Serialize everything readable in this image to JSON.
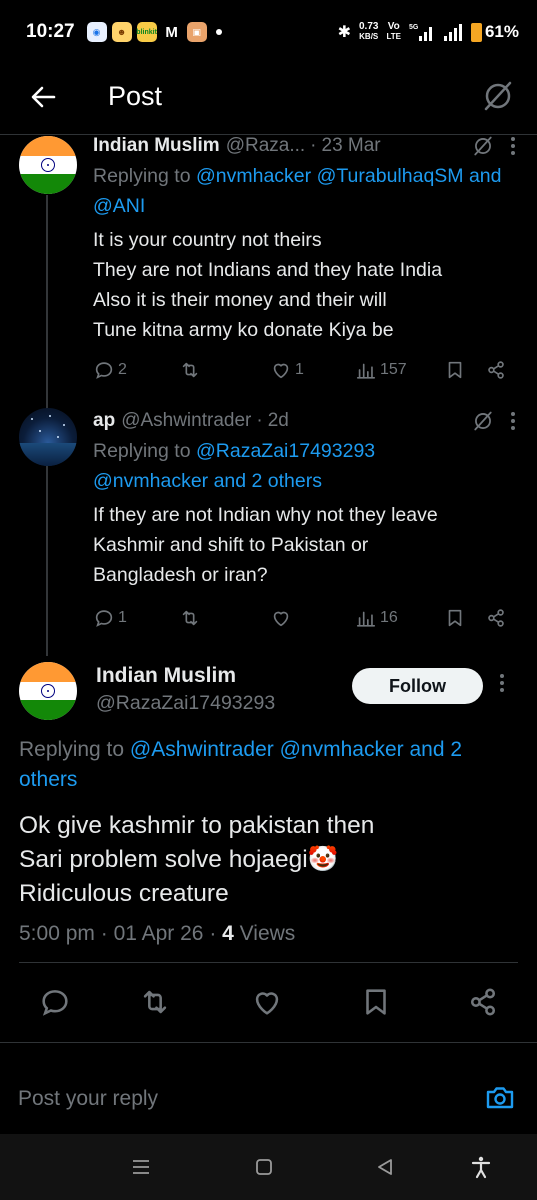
{
  "status_bar": {
    "time": "10:27",
    "net_speed": "0.73",
    "net_unit": "KB/S",
    "volte": "Vo",
    "lte": "LTE",
    "signal_5g": "5G",
    "battery": "61%",
    "notif_icons": [
      "blinkit",
      "gmail",
      "app"
    ]
  },
  "header": {
    "title": "Post",
    "back_icon": "arrow-left-icon",
    "grok_icon": "grok-icon"
  },
  "tweets": [
    {
      "name": "Indian Muslim",
      "handle": "@Raza...",
      "date": "23 Mar",
      "reply_prefix": "Replying to ",
      "reply_mentions": "@nvmhacker @TurabulhaqSM and @ANI",
      "lines": [
        "It is your country not theirs",
        "They are not Indians and they hate India",
        "Also it is their money and their will",
        "Tune kitna army ko donate Kiya be"
      ],
      "replies": "2",
      "reposts": "",
      "likes": "1",
      "views": "157"
    },
    {
      "name": "ap",
      "handle": "@Ashwintrader",
      "date": "2d",
      "reply_prefix": "Replying to ",
      "reply_mentions_line1": "@RazaZai17493293",
      "reply_mentions_line2": "@nvmhacker and 2 others",
      "lines": [
        "If they are not Indian why not they leave",
        "Kashmir and shift to Pakistan or",
        "Bangladesh or iran?"
      ],
      "replies": "1",
      "reposts": "",
      "likes": "",
      "views": "16"
    }
  ],
  "main_tweet": {
    "name": "Indian Muslim",
    "handle": "@RazaZai17493293",
    "follow_label": "Follow",
    "reply_prefix": "Replying to ",
    "reply_mentions_line1": "@Ashwintrader @nvmhacker and 2",
    "reply_mentions_line2": "others",
    "lines": [
      "Ok give kashmir to pakistan then",
      "Sari problem solve hojaegi🤡",
      "Ridiculous creature"
    ],
    "time": "5:00 pm",
    "date": "01 Apr 26",
    "views_count": "4",
    "views_label": "Views"
  },
  "composer": {
    "placeholder": "Post your reply"
  },
  "colors": {
    "background": "#000000",
    "accent": "#1d9bf0",
    "muted": "#71767b",
    "text": "#e7e9ea"
  }
}
